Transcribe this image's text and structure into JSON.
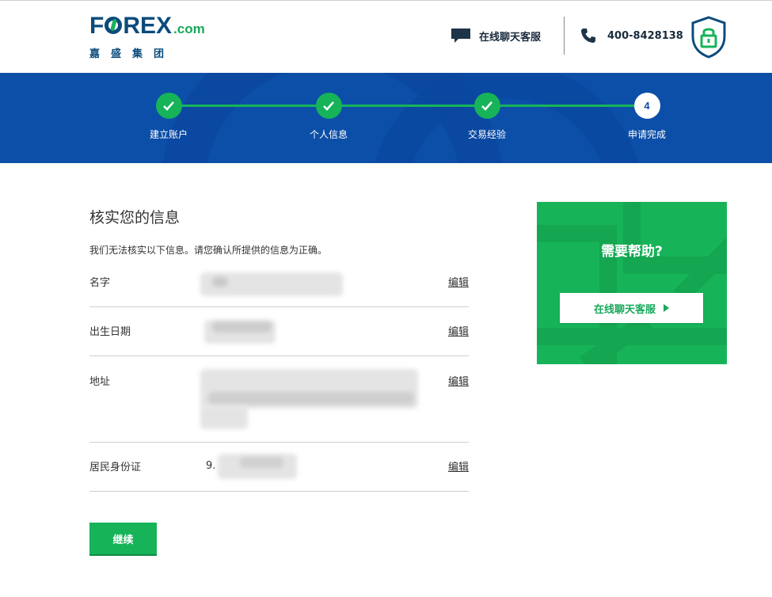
{
  "header": {
    "logo_main_left": "F",
    "logo_main_right": "REX",
    "logo_dotcom": ".com",
    "logo_sub": "嘉盛集团",
    "chat_label": "在线聊天客服",
    "phone_number": "400-8428138"
  },
  "progress": {
    "steps": [
      {
        "label": "建立账户",
        "status": "done"
      },
      {
        "label": "个人信息",
        "status": "done"
      },
      {
        "label": "交易经验",
        "status": "done"
      },
      {
        "label": "申请完成",
        "status": "current",
        "number": "4"
      }
    ]
  },
  "main": {
    "title": "核实您的信息",
    "description": "我们无法核实以下信息。请您确认所提供的信息为正确。",
    "rows": [
      {
        "label": "名字",
        "edit": "编辑"
      },
      {
        "label": "出生日期",
        "edit": "编辑"
      },
      {
        "label": "地址",
        "edit": "编辑"
      },
      {
        "label": "居民身份证",
        "prefix": "9.",
        "edit": "编辑"
      }
    ],
    "continue_label": "继续"
  },
  "help": {
    "title": "需要帮助?",
    "chat_button": "在线聊天客服"
  },
  "colors": {
    "brand_blue": "#0c4fa8",
    "brand_green": "#17b359",
    "logo_navy": "#0b4b7c"
  },
  "icons": {
    "chat": "chat-bubble-icon",
    "phone": "phone-icon",
    "security": "shield-lock-icon",
    "check": "checkmark-icon",
    "arrow": "play-arrow-icon"
  }
}
